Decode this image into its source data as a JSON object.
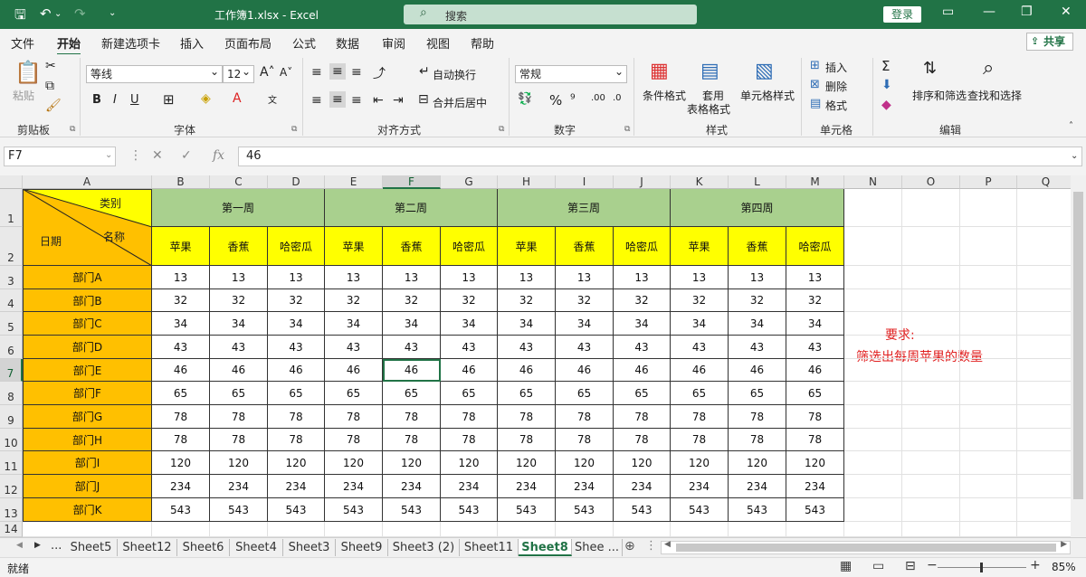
{
  "titlebar": {
    "save_icon": "save-icon",
    "undo_icon": "undo-icon",
    "redo_icon": "redo-icon",
    "title": "工作簿1.xlsx  -  Excel",
    "search_placeholder": "搜索",
    "login": "登录"
  },
  "menu": [
    "文件",
    "开始",
    "新建选项卡",
    "插入",
    "页面布局",
    "公式",
    "数据",
    "审阅",
    "视图",
    "帮助"
  ],
  "share": "共享",
  "ribbon": {
    "paste": "粘贴",
    "font_name": "等线",
    "font_size": "12",
    "bold": "B",
    "italic": "I",
    "underline": "U",
    "wrap_text": "自动换行",
    "merge_center": "合并后居中",
    "number_format": "常规",
    "conditional_format": "条件格式",
    "table_format_1": "套用",
    "table_format_2": "表格格式",
    "cell_style": "单元格样式",
    "insert": "插入",
    "delete": "删除",
    "format": "格式",
    "sort_filter": "排序和筛选",
    "find_select": "查找和选择",
    "groups": {
      "clipboard": "剪贴板",
      "font": "字体",
      "alignment": "对齐方式",
      "number": "数字",
      "styles": "样式",
      "cells": "单元格",
      "editing": "编辑"
    }
  },
  "formula_bar": {
    "name_box": "F7",
    "formula": "46"
  },
  "columns": [
    "A",
    "B",
    "C",
    "D",
    "E",
    "F",
    "G",
    "H",
    "I",
    "J",
    "K",
    "L",
    "M",
    "N",
    "O",
    "P",
    "Q"
  ],
  "rows": [
    "1",
    "2",
    "3",
    "4",
    "5",
    "6",
    "7",
    "8",
    "9",
    "10",
    "11",
    "12",
    "13",
    "14"
  ],
  "table": {
    "corner": {
      "category": "类别",
      "name": "名称",
      "date": "日期"
    },
    "weeks": [
      "第一周",
      "第二周",
      "第三周",
      "第四周"
    ],
    "fruits": [
      "苹果",
      "香蕉",
      "哈密瓜"
    ],
    "departments": [
      "部门A",
      "部门B",
      "部门C",
      "部门D",
      "部门E",
      "部门F",
      "部门G",
      "部门H",
      "部门I",
      "部门J",
      "部门K"
    ],
    "values": [
      13,
      32,
      34,
      43,
      46,
      65,
      78,
      78,
      120,
      234,
      543
    ]
  },
  "note": {
    "line1": "要求:",
    "line2": "筛选出每周苹果的数量"
  },
  "sheets": [
    "Sheet5",
    "Sheet12",
    "Sheet6",
    "Sheet4",
    "Sheet3",
    "Sheet9",
    "Sheet3 (2)",
    "Sheet11",
    "Sheet8",
    "Shee ..."
  ],
  "active_sheet": "Sheet8",
  "tab_nav": [
    "◀",
    "▶",
    "..."
  ],
  "status": {
    "ready": "就绪",
    "zoom": "85%"
  }
}
